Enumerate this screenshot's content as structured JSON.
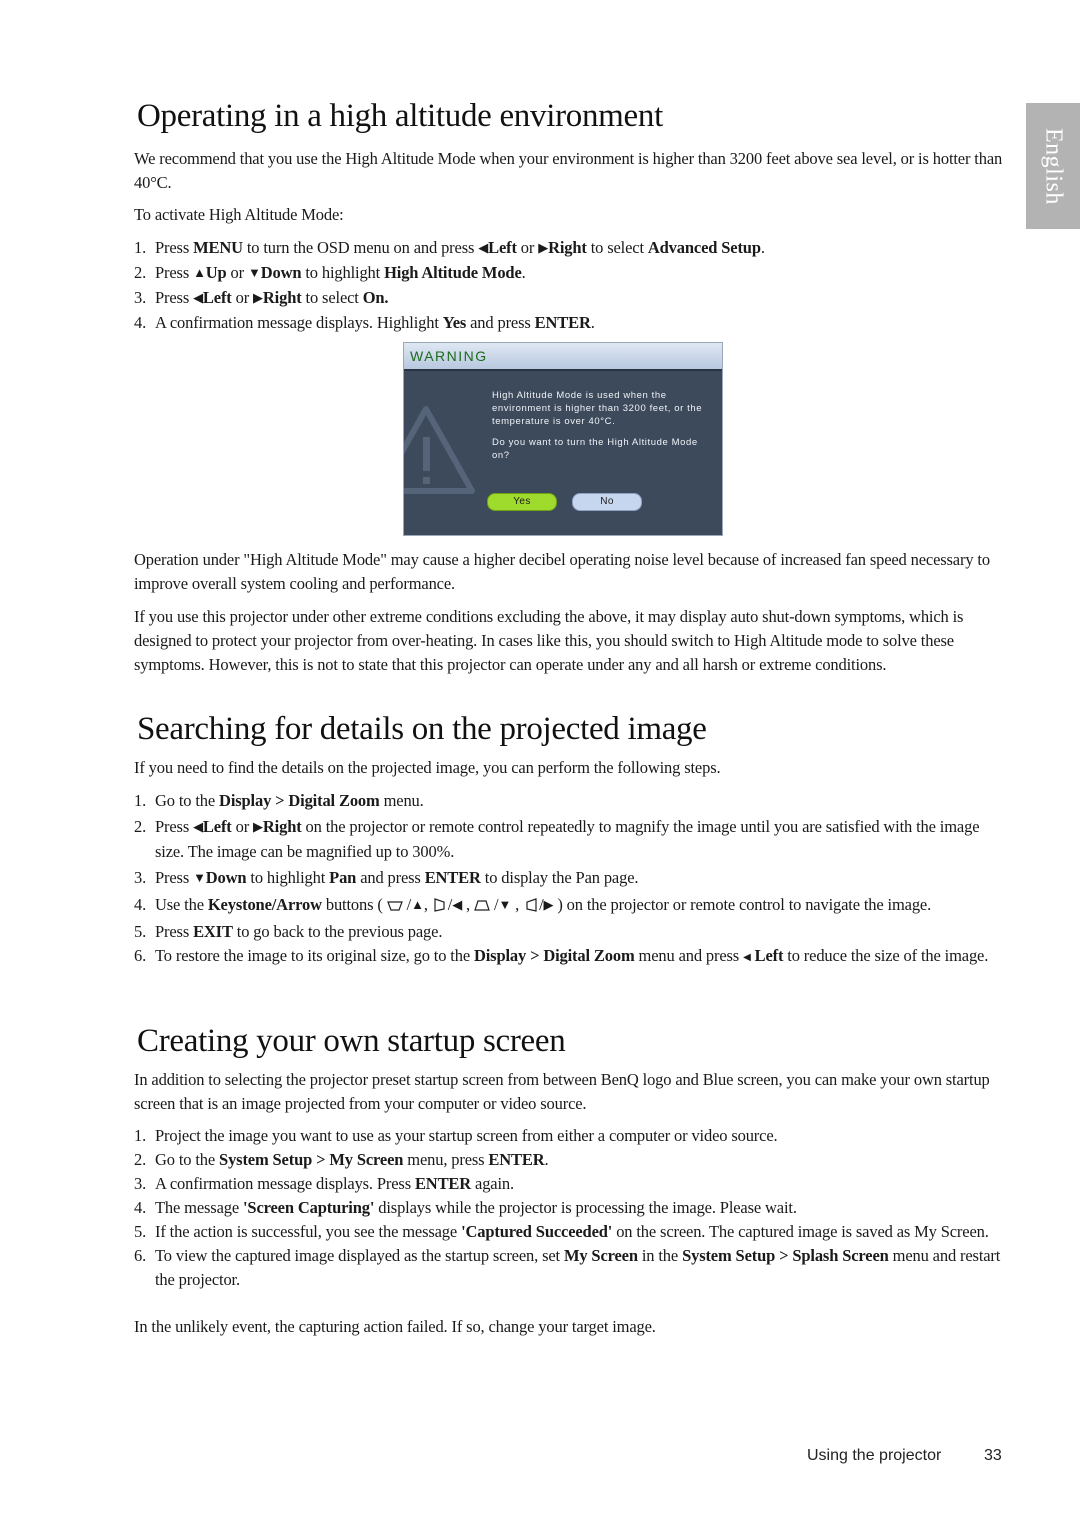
{
  "language_tab": "English",
  "sections": {
    "high_altitude": {
      "title": "Operating in a high altitude environment",
      "intro": "We recommend that you use the High Altitude Mode when your environment is higher than 3200 feet above sea level, or is hotter than 40°C.",
      "activate_label": "To activate High Altitude Mode:",
      "steps": [
        {
          "num": "1.",
          "parts": [
            "Press ",
            "MENU",
            " to turn the OSD menu on and press ",
            "Left",
            " or ",
            "Right",
            " to select ",
            "Advanced Setup",
            "."
          ]
        },
        {
          "num": "2.",
          "parts": [
            "Press ",
            "Up",
            " or ",
            "Down",
            " to highlight ",
            "High Altitude Mode",
            "."
          ]
        },
        {
          "num": "3.",
          "parts": [
            "Press ",
            "Left",
            " or ",
            "Right",
            " to select ",
            "On."
          ]
        },
        {
          "num": "4.",
          "parts": [
            "A confirmation message displays. Highlight ",
            "Yes",
            " and press ",
            "ENTER",
            "."
          ]
        }
      ],
      "dialog": {
        "header": "WARNING",
        "message": "High Altitude Mode is used when the environment is higher than 3200 feet, or the temperature is over 40°C.",
        "question": "Do you want to turn the High Altitude Mode on?",
        "yes_label": "Yes",
        "no_label": "No",
        "icon": "warning-triangle-icon"
      },
      "para1": "Operation under \"High Altitude Mode\" may cause a higher decibel operating noise level  because of increased fan speed necessary to improve overall system cooling and performance.",
      "para2": "If you use this projector under other extreme conditions excluding the above, it may display auto shut-down symptoms, which is designed to protect your projector from over-heating. In cases like this, you should switch to High Altitude mode to solve these symptoms. However, this is not to state that this projector can operate under any and all harsh or extreme conditions."
    },
    "searching": {
      "title": "Searching for details on the projected image",
      "intro": "If you need to find the details on the projected image, you can perform the following steps.",
      "steps": {
        "s1": {
          "num": "1.",
          "a": "Go to the ",
          "b": "Display > Digital Zoom",
          "c": " menu."
        },
        "s2": {
          "num": "2.",
          "a": "Press ",
          "left": "Left",
          "or": " or ",
          "right": "Right",
          "c": " on the  projector or remote control repeatedly to magnify the image until you are satisfied with the image size. The image can be magnified up to 300%."
        },
        "s3": {
          "num": "3.",
          "a": "Press ",
          "down": "Down",
          "b": " to highlight ",
          "pan": "Pan",
          "c": " and press ",
          "enter": "ENTER",
          "d": " to display the Pan page."
        },
        "s4": {
          "num": "4.",
          "a": "Use the ",
          "b": "Keystone/Arrow",
          "c": " buttons ( ",
          "d": " ) on the projector or remote control to navigate the image."
        },
        "s5": {
          "num": "5.",
          "a": "Press ",
          "b": "EXIT",
          "c": " to go back to the previous page."
        },
        "s6": {
          "num": "6.",
          "a": "To restore the image to its original size, go to the ",
          "b": "Display > Digital Zoom",
          "c": " menu and press ",
          "left": "Left",
          "d": " to reduce the size of the image."
        }
      }
    },
    "startup": {
      "title": "Creating your own startup screen",
      "intro": "In addition to selecting the projector preset startup screen from between BenQ logo and Blue screen, you can make your own startup screen that is an image projected from your computer or video source.",
      "steps": {
        "s1": {
          "num": "1.",
          "a": "Project the image you want to use as your startup screen from either a computer or video source."
        },
        "s2": {
          "num": "2.",
          "a": "Go to the ",
          "b": "System Setup > My Screen",
          "c": " menu, press ",
          "d": "ENTER",
          "e": "."
        },
        "s3": {
          "num": "3.",
          "a": "A confirmation message displays. Press ",
          "b": "ENTER",
          "c": " again."
        },
        "s4": {
          "num": "4.",
          "a": "The message ",
          "b": "'Screen Capturing'",
          "c": " displays while the projector is processing the image. Please wait."
        },
        "s5": {
          "num": "5.",
          "a": "If the action is successful, you see the message ",
          "b": "'Captured Succeeded'",
          "c": " on the screen. The captured image is saved as My Screen."
        },
        "s6": {
          "num": "6.",
          "a": "To view the captured image displayed as the startup screen, set ",
          "b": "My Screen",
          "c": " in the ",
          "d": "System Setup > Splash Screen",
          "e": " menu and restart the projector."
        }
      },
      "closing": "In the unlikely event, the capturing action failed. If so, change your target image."
    }
  },
  "footer": {
    "section_label": "Using the projector",
    "page_number": "33"
  }
}
